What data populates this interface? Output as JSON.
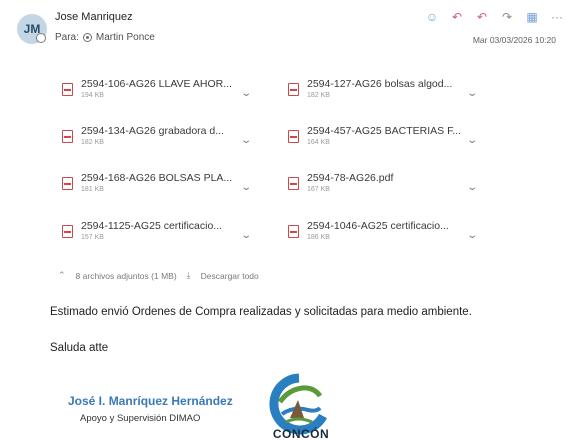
{
  "email": {
    "avatar_initials": "JM",
    "sender": "Jose Manriquez",
    "to_label": "Para:",
    "recipient": "Martin Ponce",
    "date": "Mar 03/03/2026 10:20"
  },
  "actions": [
    {
      "icon": "smiley-icon",
      "glyph": "☺",
      "color": "blue"
    },
    {
      "icon": "reply-icon",
      "glyph": "↶",
      "color": "pink"
    },
    {
      "icon": "reply-all-icon",
      "glyph": "↶",
      "color": "pink"
    },
    {
      "icon": "forward-icon",
      "glyph": "↷",
      "color": "grey"
    },
    {
      "icon": "apps-icon",
      "glyph": "▦",
      "color": "blue"
    },
    {
      "icon": "more-icon",
      "glyph": "···",
      "color": "grey"
    }
  ],
  "attachments": [
    {
      "name": "2594-106-AG26 LLAVE AHOR...",
      "size": "194 KB"
    },
    {
      "name": "2594-127-AG26 bolsas algod...",
      "size": "182 KB"
    },
    {
      "name": "2594-134-AG26 grabadora d...",
      "size": "182 KB"
    },
    {
      "name": "2594-457-AG25 BACTERIAS F...",
      "size": "164 KB"
    },
    {
      "name": "2594-168-AG26 BOLSAS PLA...",
      "size": "181 KB"
    },
    {
      "name": "2594-78-AG26.pdf",
      "size": "167 KB"
    },
    {
      "name": "2594-1125-AG25 certificacio...",
      "size": "157 KB"
    },
    {
      "name": "2594-1046-AG25 certificacio...",
      "size": "186 KB"
    }
  ],
  "summary": {
    "count_text": "8 archivos adjuntos (1 MB)",
    "download_text": "Descargar todo"
  },
  "body": {
    "line1": "Estimado envió Ordenes de Compra  realizadas y  solicitadas para medio ambiente.",
    "line2": "Saluda atte"
  },
  "signature": {
    "name": "José I. Manríquez Hernández",
    "role": "Apoyo y Supervisión DIMAO",
    "logo_text": "CONCÓN"
  },
  "colors": {
    "accent": "#3a78b8",
    "pdf_red": "#d64545",
    "logo_blue": "#2a7fc0",
    "logo_green": "#5a9a3a"
  }
}
